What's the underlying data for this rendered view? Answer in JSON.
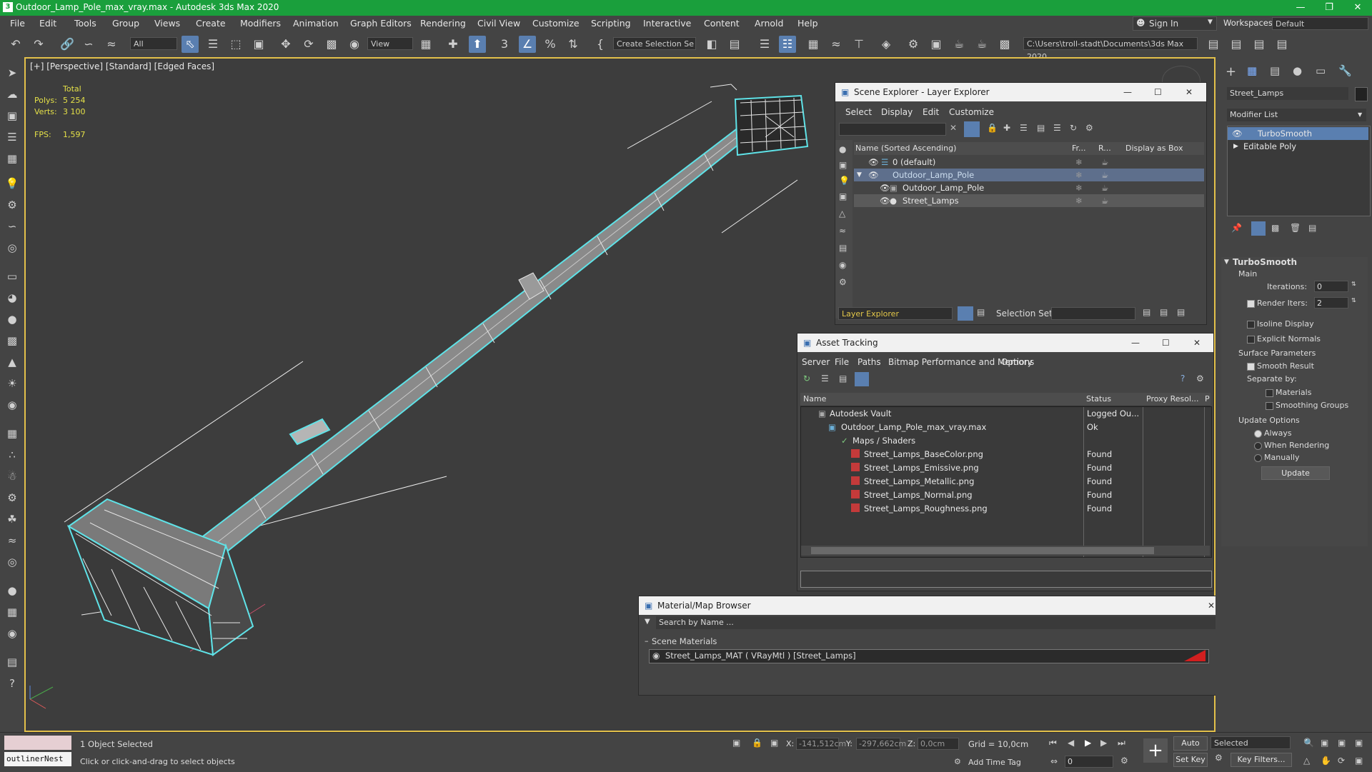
{
  "window": {
    "title": "Outdoor_Lamp_Pole_max_vray.max - Autodesk 3ds Max 2020",
    "app_icon": "3"
  },
  "menu": [
    "File",
    "Edit",
    "Tools",
    "Group",
    "Views",
    "Create",
    "Modifiers",
    "Animation",
    "Graph Editors",
    "Rendering",
    "Civil View",
    "Customize",
    "Scripting",
    "Interactive",
    "Content",
    "Arnold",
    "Help"
  ],
  "account": {
    "sign_in": "Sign In",
    "workspaces_label": "Workspaces:",
    "workspace_value": "Default"
  },
  "toolbar": {
    "filter_value": "All",
    "refcoord_value": "View",
    "selection_set_placeholder": "Create Selection Se",
    "project_path": "C:\\Users\\troll-stadt\\Documents\\3ds Max 2020",
    "snap_label": "3"
  },
  "viewport": {
    "label": "[+] [Perspective] [Standard] [Edged Faces]",
    "stats_total": "Total",
    "polys_label": "Polys:",
    "polys_value": "5 254",
    "verts_label": "Verts:",
    "verts_value": "3 100",
    "fps_label": "FPS:",
    "fps_value": "1,597"
  },
  "scene_explorer": {
    "title": "Scene Explorer - Layer Explorer",
    "menus": [
      "Select",
      "Display",
      "Edit",
      "Customize"
    ],
    "columns": [
      "Name (Sorted Ascending)",
      "Fr...",
      "R...",
      "Display as Box"
    ],
    "rows": [
      {
        "name": "0 (default)"
      },
      {
        "name": "Outdoor_Lamp_Pole"
      },
      {
        "name": "Outdoor_Lamp_Pole"
      },
      {
        "name": "Street_Lamps"
      }
    ],
    "footer_dropdown": "Layer Explorer",
    "selection_set_label": "Selection Set:"
  },
  "asset_tracking": {
    "title": "Asset Tracking",
    "menus": [
      "Server",
      "File",
      "Paths",
      "Bitmap Performance and Memory",
      "Options"
    ],
    "columns": [
      "Name",
      "Status",
      "Proxy Resol...",
      "P"
    ],
    "rows": [
      {
        "name": "Autodesk Vault",
        "status": "Logged Ou..."
      },
      {
        "name": "Outdoor_Lamp_Pole_max_vray.max",
        "status": "Ok"
      },
      {
        "name": "Maps / Shaders",
        "status": ""
      },
      {
        "name": "Street_Lamps_BaseColor.png",
        "status": "Found"
      },
      {
        "name": "Street_Lamps_Emissive.png",
        "status": "Found"
      },
      {
        "name": "Street_Lamps_Metallic.png",
        "status": "Found"
      },
      {
        "name": "Street_Lamps_Normal.png",
        "status": "Found"
      },
      {
        "name": "Street_Lamps_Roughness.png",
        "status": "Found"
      }
    ]
  },
  "material_browser": {
    "title": "Material/Map Browser",
    "search_placeholder": "Search by Name ...",
    "section": "Scene Materials",
    "material": "Street_Lamps_MAT  ( VRayMtl )  [Street_Lamps]"
  },
  "command_panel": {
    "object_name": "Street_Lamps",
    "modifier_list": "Modifier List",
    "stack": [
      "TurboSmooth",
      "Editable Poly"
    ],
    "rollout_title": "TurboSmooth",
    "main_label": "Main",
    "iterations_label": "Iterations:",
    "iterations_value": "0",
    "render_iters_label": "Render Iters:",
    "render_iters_value": "2",
    "isoline_label": "Isoline Display",
    "explicit_normals_label": "Explicit Normals",
    "surface_params_label": "Surface Parameters",
    "smooth_result_label": "Smooth Result",
    "separate_by_label": "Separate by:",
    "materials_label": "Materials",
    "smoothing_groups_label": "Smoothing Groups",
    "update_options_label": "Update Options",
    "always_label": "Always",
    "when_rendering_label": "When Rendering",
    "manually_label": "Manually",
    "update_button": "Update"
  },
  "status": {
    "script_listener": "outlinerNest",
    "selected_text": "1 Object Selected",
    "prompt": "Click or click-and-drag to select objects",
    "x_label": "X:",
    "x_value": "-141,512cm",
    "y_label": "Y:",
    "y_value": "-297,662cm",
    "z_label": "Z:",
    "z_value": "0,0cm",
    "grid": "Grid = 10,0cm",
    "add_time_tag": "Add Time Tag",
    "auto_key": "Auto Key",
    "set_key": "Set Key",
    "key_dropdown": "Selected",
    "frame_value": "0",
    "key_filters": "Key Filters..."
  },
  "colors": {
    "title_green": "#1a9f3c",
    "selection_cyan": "#5fe3e8",
    "viewport_border": "#e3c04a",
    "stats_yellow": "#e4e048"
  }
}
